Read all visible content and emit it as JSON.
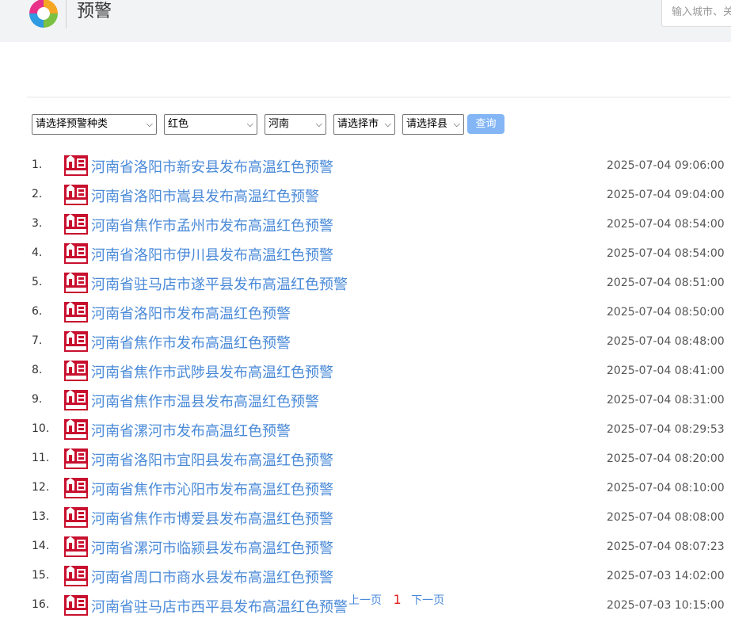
{
  "header": {
    "title": "预警",
    "search_placeholder": "输入城市、关键词"
  },
  "filters": {
    "type_label": "请选择预警种类",
    "color_label": "红色",
    "province_label": "河南",
    "city_label": "请选择市",
    "county_label": "请选择县",
    "query_label": "查询"
  },
  "warnings": [
    {
      "index": "1.",
      "title": "河南省洛阳市新安县发布高温红色预警",
      "time": "2025-07-04 09:06:00"
    },
    {
      "index": "2.",
      "title": "河南省洛阳市嵩县发布高温红色预警",
      "time": "2025-07-04 09:04:00"
    },
    {
      "index": "3.",
      "title": "河南省焦作市孟州市发布高温红色预警",
      "time": "2025-07-04 08:54:00"
    },
    {
      "index": "4.",
      "title": "河南省洛阳市伊川县发布高温红色预警",
      "time": "2025-07-04 08:54:00"
    },
    {
      "index": "5.",
      "title": "河南省驻马店市遂平县发布高温红色预警",
      "time": "2025-07-04 08:51:00"
    },
    {
      "index": "6.",
      "title": "河南省洛阳市发布高温红色预警",
      "time": "2025-07-04 08:50:00"
    },
    {
      "index": "7.",
      "title": "河南省焦作市发布高温红色预警",
      "time": "2025-07-04 08:48:00"
    },
    {
      "index": "8.",
      "title": "河南省焦作市武陟县发布高温红色预警",
      "time": "2025-07-04 08:41:00"
    },
    {
      "index": "9.",
      "title": "河南省焦作市温县发布高温红色预警",
      "time": "2025-07-04 08:31:00"
    },
    {
      "index": "10.",
      "title": "河南省漯河市发布高温红色预警",
      "time": "2025-07-04 08:29:53"
    },
    {
      "index": "11.",
      "title": "河南省洛阳市宜阳县发布高温红色预警",
      "time": "2025-07-04 08:20:00"
    },
    {
      "index": "12.",
      "title": "河南省焦作市沁阳市发布高温红色预警",
      "time": "2025-07-04 08:10:00"
    },
    {
      "index": "13.",
      "title": "河南省焦作市博爱县发布高温红色预警",
      "time": "2025-07-04 08:08:00"
    },
    {
      "index": "14.",
      "title": "河南省漯河市临颍县发布高温红色预警",
      "time": "2025-07-04 08:07:23"
    },
    {
      "index": "15.",
      "title": "河南省周口市商水县发布高温红色预警",
      "time": "2025-07-03 14:02:00"
    },
    {
      "index": "16.",
      "title": "河南省驻马店市西平县发布高温红色预警",
      "time": "2025-07-03 10:15:00"
    }
  ],
  "pager": {
    "prev_label": "上一页",
    "current_page": "1",
    "next_label": "下一页"
  },
  "icons": {
    "logo": "rainbow-swirl-logo",
    "warning": "high-temperature-red-warning-icon"
  },
  "colors": {
    "link": "#4a8ad8",
    "button": "#84b6f6",
    "warning_red": "#c8102e",
    "current_page": "#e02020"
  }
}
